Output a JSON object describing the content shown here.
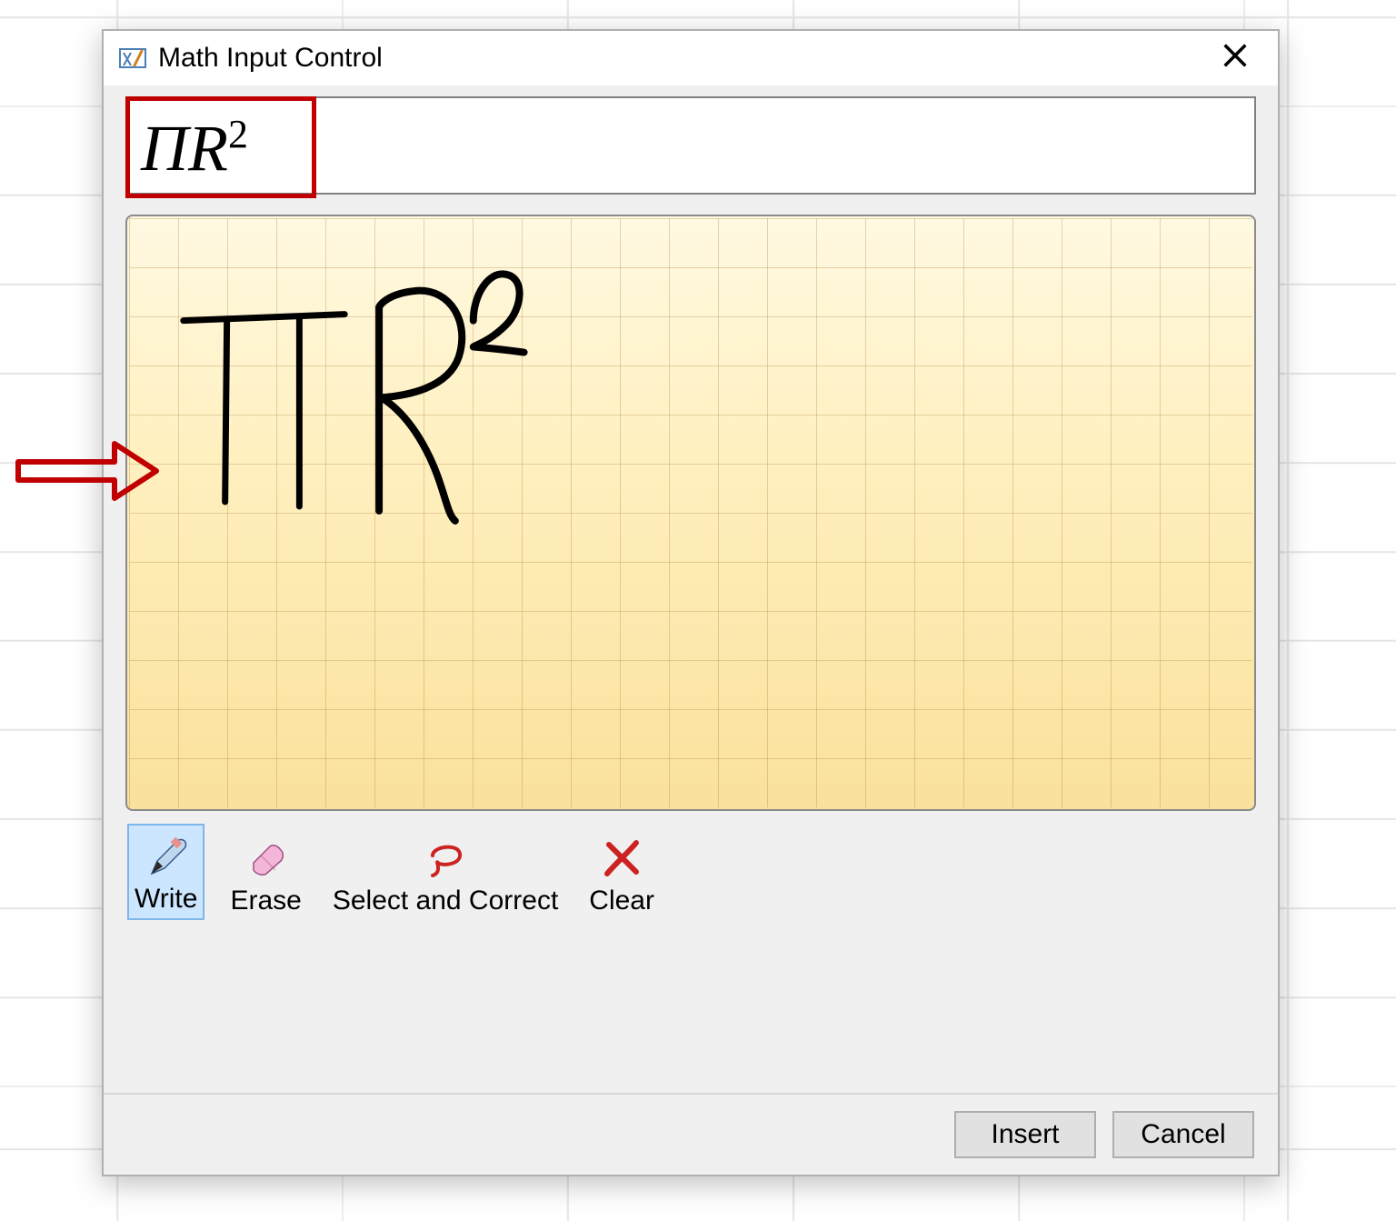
{
  "dialog": {
    "title": "Math Input Control",
    "close_label": "✕"
  },
  "preview": {
    "formula_base": "ΠR",
    "formula_exp": "2"
  },
  "canvas": {
    "handwriting": "πR²"
  },
  "toolbar": {
    "write": "Write",
    "erase": "Erase",
    "select_correct": "Select and Correct",
    "clear": "Clear",
    "selected": "write"
  },
  "footer": {
    "insert": "Insert",
    "cancel": "Cancel"
  }
}
